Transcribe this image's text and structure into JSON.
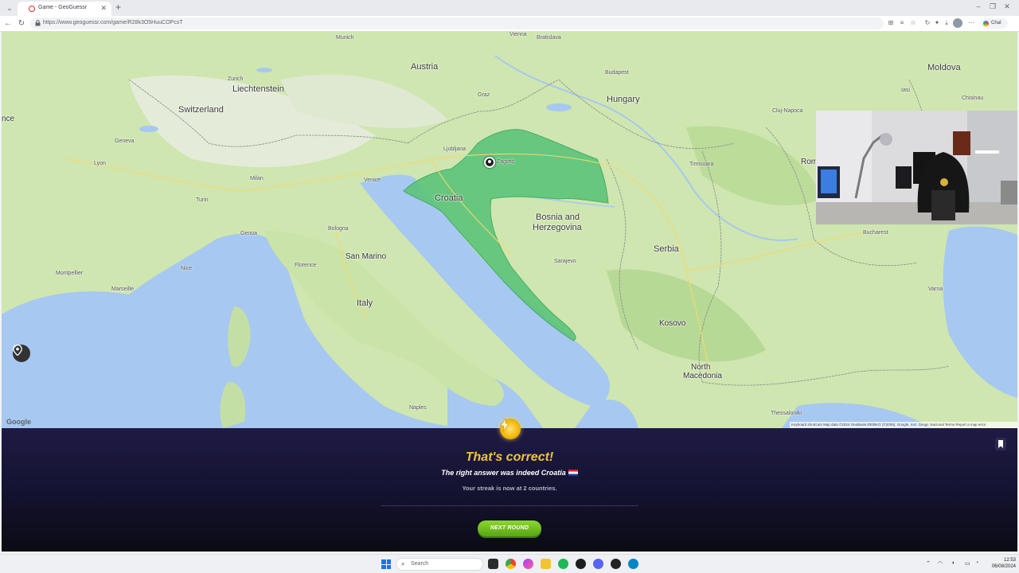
{
  "browser": {
    "tab_title": "Game - GeoGuessr",
    "url": "https://www.geoguessr.com/game/R28k3O5HuuCOPcsT",
    "chat_label": "Chat"
  },
  "map": {
    "countries": [
      "Austria",
      "Hungary",
      "Moldova",
      "Switzerland",
      "Liechtenstein",
      "Croatia",
      "Bosnia and",
      "Herzegovina",
      "Serbia",
      "San Marino",
      "Italy",
      "Kosovo",
      "North",
      "Macedonia",
      "Rom",
      "nce"
    ],
    "cities": [
      "Munich",
      "Vienna",
      "Bratislava",
      "Budapest",
      "Zurich",
      "Graz",
      "Ljubljana",
      "Zagreb",
      "Milan",
      "Venice",
      "Turin",
      "Bologna",
      "Florence",
      "Genoa",
      "Nice",
      "Montpellier",
      "Marseille",
      "Lyon",
      "Geneva",
      "Sarajevo",
      "Naples",
      "Bucharest",
      "Cluj-Napoca",
      "Timisoara",
      "Chisinau",
      "Iasi",
      "Varna",
      "Thessaloniki"
    ],
    "google_logo": "Google",
    "attribution": "Keyboard shortcuts   Map data ©2024 GeoBasis-DE/BKG (©2009), Google, Inst. Geogr. Nacional   Terms   Report a map error"
  },
  "result": {
    "title": "That's correct!",
    "subtitle": "The right answer was indeed Croatia",
    "streak": "Your streak is now at 2 countries.",
    "next_button": "NEXT ROUND"
  },
  "taskbar": {
    "search_placeholder": "Search",
    "time": "12:53",
    "date": "06/08/2024"
  },
  "colors": {
    "highlight_country": "#5cc47a",
    "title_gold": "#f4c33a",
    "button_green": "#6abf1e",
    "panel_bg": "#141331"
  },
  "icons": [
    "back-icon",
    "forward-icon",
    "refresh-icon",
    "lock-icon",
    "star-icon",
    "extensions-icon",
    "menu-icon",
    "location-pin-icon",
    "locate-icon",
    "bolt-icon",
    "bookmark-icon",
    "windows-start-icon",
    "search-icon"
  ]
}
